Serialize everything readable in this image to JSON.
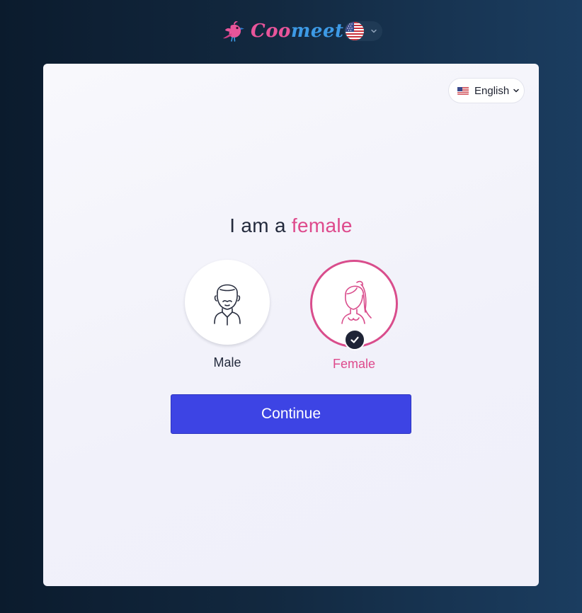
{
  "brand": {
    "name_part1": "Coo",
    "name_part2": "meet",
    "pink": "#e8559a",
    "blue": "#3d9ae6"
  },
  "header": {
    "language_flag_icon": "us-flag-icon",
    "language_chevron_icon": "chevron-down-icon"
  },
  "card": {
    "language_selector": {
      "label": "English",
      "flag_icon": "us-flag-icon",
      "chevron_icon": "chevron-down-icon"
    },
    "headline": {
      "prefix": "I am a",
      "selected_gender": "female",
      "accent_color": "#de4a8c"
    },
    "gender_options": [
      {
        "label": "Male",
        "icon": "male-avatar-icon",
        "selected": false
      },
      {
        "label": "Female",
        "icon": "female-avatar-icon",
        "selected": true
      }
    ],
    "selected_indicator_icon": "checkmark-icon",
    "continue_label": "Continue",
    "continue_color": "#3d44e4"
  }
}
